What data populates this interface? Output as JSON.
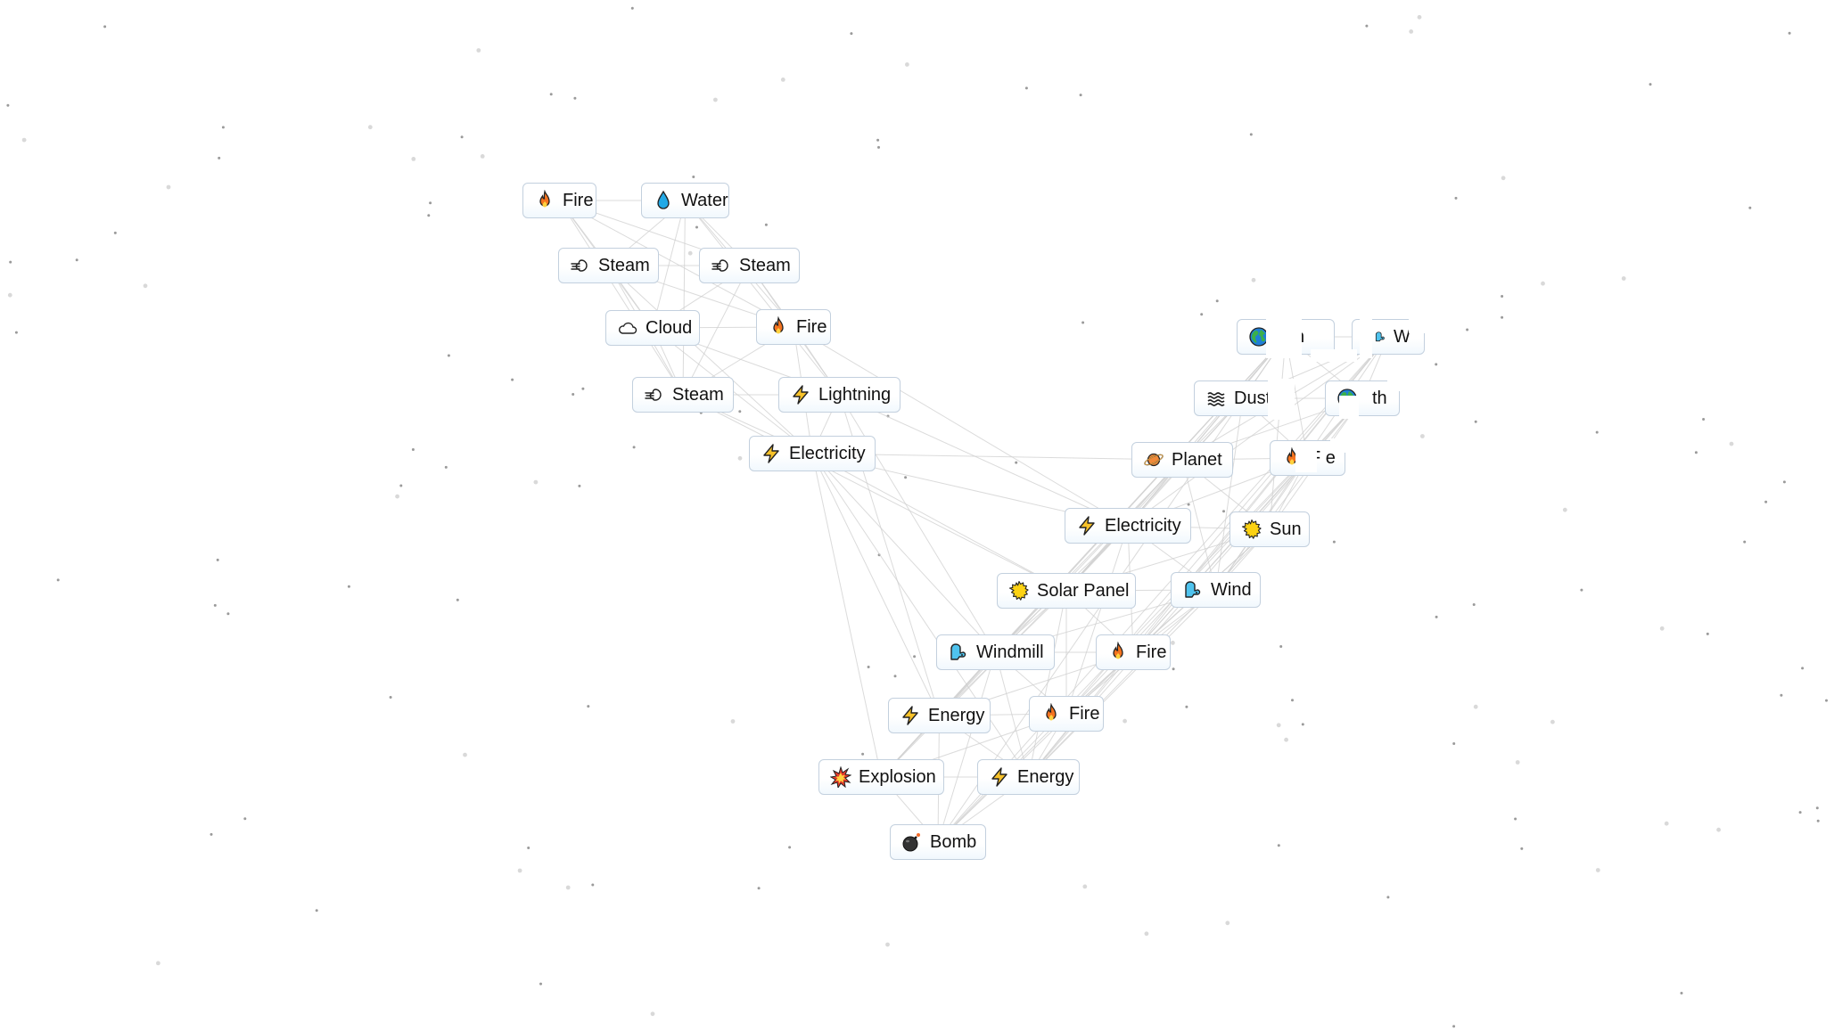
{
  "app": {
    "background_color": "#ffffff",
    "node_border_color": "#c3d0de",
    "link_color": "#cfcfcf"
  },
  "nodes": [
    {
      "id": "n1",
      "label": "Fire",
      "icon": "fire-icon"
    },
    {
      "id": "n2",
      "label": "Water",
      "icon": "water-drop-icon"
    },
    {
      "id": "n3",
      "label": "Steam",
      "icon": "steam-icon"
    },
    {
      "id": "n4",
      "label": "Steam",
      "icon": "steam-icon"
    },
    {
      "id": "n5",
      "label": "Cloud",
      "icon": "cloud-icon"
    },
    {
      "id": "n6",
      "label": "Fire",
      "icon": "fire-icon"
    },
    {
      "id": "n7",
      "label": "Steam",
      "icon": "steam-icon"
    },
    {
      "id": "n8",
      "label": "Lightning",
      "icon": "lightning-icon"
    },
    {
      "id": "n9",
      "label": "Electricity",
      "icon": "lightning-icon"
    },
    {
      "id": "n10",
      "label": "n",
      "icon": "earth-globe-icon",
      "partial": true
    },
    {
      "id": "n11",
      "label": "W",
      "icon": "wind-icon",
      "partial": true
    },
    {
      "id": "n12",
      "label": "Dust",
      "icon": "dust-waves-icon",
      "partial": true
    },
    {
      "id": "n13",
      "label": "th",
      "icon": "earth-globe-icon",
      "partial": true
    },
    {
      "id": "n14",
      "label": "Planet",
      "icon": "planet-icon"
    },
    {
      "id": "n15",
      "label": "F e",
      "icon": "fire-icon",
      "partial": true
    },
    {
      "id": "n16",
      "label": "Electricity",
      "icon": "lightning-icon"
    },
    {
      "id": "n17",
      "label": "Sun",
      "icon": "sun-icon"
    },
    {
      "id": "n18",
      "label": "Solar Panel",
      "icon": "sun-icon"
    },
    {
      "id": "n19",
      "label": "Wind",
      "icon": "wind-icon"
    },
    {
      "id": "n20",
      "label": "Windmill",
      "icon": "wind-icon"
    },
    {
      "id": "n21",
      "label": "Fire",
      "icon": "fire-icon"
    },
    {
      "id": "n22",
      "label": "Energy",
      "icon": "lightning-icon"
    },
    {
      "id": "n23",
      "label": "Fire",
      "icon": "fire-icon"
    },
    {
      "id": "n24",
      "label": "Explosion",
      "icon": "explosion-icon"
    },
    {
      "id": "n25",
      "label": "Energy",
      "icon": "lightning-icon"
    },
    {
      "id": "n26",
      "label": "Bomb",
      "icon": "bomb-icon"
    }
  ],
  "links": [
    [
      "n1",
      "n2"
    ],
    [
      "n1",
      "n3"
    ],
    [
      "n1",
      "n4"
    ],
    [
      "n1",
      "n5"
    ],
    [
      "n1",
      "n7"
    ],
    [
      "n1",
      "n6"
    ],
    [
      "n2",
      "n3"
    ],
    [
      "n2",
      "n4"
    ],
    [
      "n2",
      "n5"
    ],
    [
      "n2",
      "n7"
    ],
    [
      "n2",
      "n6"
    ],
    [
      "n2",
      "n8"
    ],
    [
      "n3",
      "n4"
    ],
    [
      "n3",
      "n5"
    ],
    [
      "n3",
      "n7"
    ],
    [
      "n3",
      "n6"
    ],
    [
      "n3",
      "n9"
    ],
    [
      "n4",
      "n5"
    ],
    [
      "n4",
      "n7"
    ],
    [
      "n4",
      "n6"
    ],
    [
      "n4",
      "n8"
    ],
    [
      "n5",
      "n6"
    ],
    [
      "n5",
      "n7"
    ],
    [
      "n5",
      "n8"
    ],
    [
      "n5",
      "n9"
    ],
    [
      "n6",
      "n7"
    ],
    [
      "n6",
      "n8"
    ],
    [
      "n6",
      "n9"
    ],
    [
      "n6",
      "n16"
    ],
    [
      "n7",
      "n8"
    ],
    [
      "n7",
      "n9"
    ],
    [
      "n7",
      "n18"
    ],
    [
      "n8",
      "n9"
    ],
    [
      "n8",
      "n16"
    ],
    [
      "n8",
      "n20"
    ],
    [
      "n8",
      "n22"
    ],
    [
      "n9",
      "n16"
    ],
    [
      "n9",
      "n18"
    ],
    [
      "n9",
      "n20"
    ],
    [
      "n9",
      "n22"
    ],
    [
      "n9",
      "n24"
    ],
    [
      "n9",
      "n14"
    ],
    [
      "n9",
      "n25"
    ],
    [
      "n10",
      "n11"
    ],
    [
      "n10",
      "n12"
    ],
    [
      "n10",
      "n13"
    ],
    [
      "n10",
      "n14"
    ],
    [
      "n10",
      "n15"
    ],
    [
      "n10",
      "n16"
    ],
    [
      "n10",
      "n17"
    ],
    [
      "n10",
      "n18"
    ],
    [
      "n10",
      "n20"
    ],
    [
      "n10",
      "n22"
    ],
    [
      "n10",
      "n24"
    ],
    [
      "n10",
      "n26"
    ],
    [
      "n11",
      "n12"
    ],
    [
      "n11",
      "n13"
    ],
    [
      "n11",
      "n14"
    ],
    [
      "n11",
      "n16"
    ],
    [
      "n11",
      "n19"
    ],
    [
      "n11",
      "n21"
    ],
    [
      "n11",
      "n23"
    ],
    [
      "n11",
      "n25"
    ],
    [
      "n11",
      "n26"
    ],
    [
      "n12",
      "n13"
    ],
    [
      "n12",
      "n14"
    ],
    [
      "n12",
      "n15"
    ],
    [
      "n12",
      "n16"
    ],
    [
      "n12",
      "n18"
    ],
    [
      "n12",
      "n19"
    ],
    [
      "n13",
      "n14"
    ],
    [
      "n13",
      "n17"
    ],
    [
      "n13",
      "n19"
    ],
    [
      "n13",
      "n21"
    ],
    [
      "n13",
      "n23"
    ],
    [
      "n13",
      "n25"
    ],
    [
      "n13",
      "n26"
    ],
    [
      "n14",
      "n15"
    ],
    [
      "n14",
      "n16"
    ],
    [
      "n14",
      "n17"
    ],
    [
      "n14",
      "n18"
    ],
    [
      "n14",
      "n19"
    ],
    [
      "n14",
      "n20"
    ],
    [
      "n14",
      "n22"
    ],
    [
      "n15",
      "n16"
    ],
    [
      "n15",
      "n17"
    ],
    [
      "n15",
      "n19"
    ],
    [
      "n15",
      "n21"
    ],
    [
      "n16",
      "n17"
    ],
    [
      "n16",
      "n18"
    ],
    [
      "n16",
      "n19"
    ],
    [
      "n16",
      "n20"
    ],
    [
      "n16",
      "n21"
    ],
    [
      "n16",
      "n23"
    ],
    [
      "n16",
      "n24"
    ],
    [
      "n17",
      "n18"
    ],
    [
      "n17",
      "n19"
    ],
    [
      "n17",
      "n21"
    ],
    [
      "n17",
      "n23"
    ],
    [
      "n17",
      "n25"
    ],
    [
      "n18",
      "n19"
    ],
    [
      "n18",
      "n20"
    ],
    [
      "n18",
      "n21"
    ],
    [
      "n18",
      "n22"
    ],
    [
      "n18",
      "n23"
    ],
    [
      "n18",
      "n25"
    ],
    [
      "n19",
      "n20"
    ],
    [
      "n19",
      "n21"
    ],
    [
      "n19",
      "n23"
    ],
    [
      "n19",
      "n25"
    ],
    [
      "n20",
      "n21"
    ],
    [
      "n20",
      "n22"
    ],
    [
      "n20",
      "n23"
    ],
    [
      "n20",
      "n24"
    ],
    [
      "n20",
      "n25"
    ],
    [
      "n20",
      "n26"
    ],
    [
      "n21",
      "n22"
    ],
    [
      "n21",
      "n23"
    ],
    [
      "n21",
      "n25"
    ],
    [
      "n21",
      "n26"
    ],
    [
      "n22",
      "n23"
    ],
    [
      "n22",
      "n24"
    ],
    [
      "n22",
      "n25"
    ],
    [
      "n22",
      "n26"
    ],
    [
      "n23",
      "n24"
    ],
    [
      "n23",
      "n25"
    ],
    [
      "n23",
      "n26"
    ],
    [
      "n24",
      "n25"
    ],
    [
      "n24",
      "n26"
    ],
    [
      "n25",
      "n26"
    ]
  ]
}
